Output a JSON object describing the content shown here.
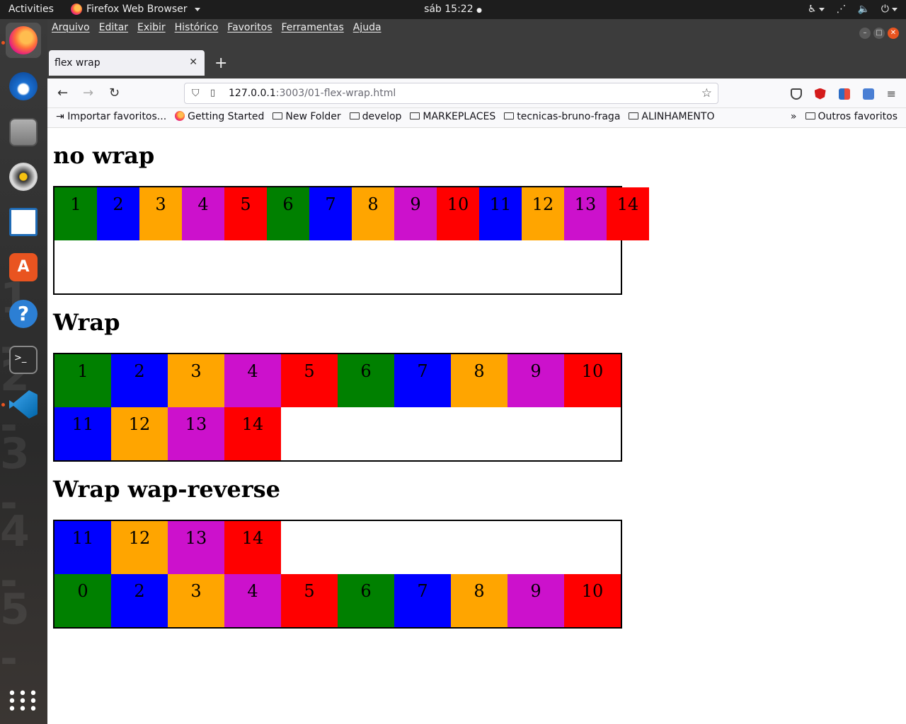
{
  "system": {
    "activities": "Activities",
    "app_name": "Firefox Web Browser",
    "clock": "sáb 15:22"
  },
  "browser": {
    "menu": [
      "Arquivo",
      "Editar",
      "Exibir",
      "Histórico",
      "Favoritos",
      "Ferramentas",
      "Ajuda"
    ],
    "tab_title": "flex wrap",
    "url_host": "127.0.0.1",
    "url_rest": ":3003/01-flex-wrap.html",
    "bookmarks": [
      "Importar favoritos...",
      "Getting Started",
      "New Folder",
      "develop",
      "MARKEPLACES",
      "tecnicas-bruno-fraga",
      "ALINHAMENTO"
    ],
    "other_bookmarks": "Outros favoritos"
  },
  "page": {
    "sections": [
      {
        "title": "no wrap",
        "items": [
          {
            "label": "1",
            "color": "green"
          },
          {
            "label": "2",
            "color": "blue"
          },
          {
            "label": "3",
            "color": "orange"
          },
          {
            "label": "4",
            "color": "purple"
          },
          {
            "label": "5",
            "color": "red"
          },
          {
            "label": "6",
            "color": "green"
          },
          {
            "label": "7",
            "color": "blue"
          },
          {
            "label": "8",
            "color": "orange"
          },
          {
            "label": "9",
            "color": "purple"
          },
          {
            "label": "10",
            "color": "red"
          },
          {
            "label": "11",
            "color": "blue"
          },
          {
            "label": "12",
            "color": "orange"
          },
          {
            "label": "13",
            "color": "purple"
          },
          {
            "label": "14",
            "color": "red"
          }
        ]
      },
      {
        "title": "Wrap",
        "items": [
          {
            "label": "1",
            "color": "green"
          },
          {
            "label": "2",
            "color": "blue"
          },
          {
            "label": "3",
            "color": "orange"
          },
          {
            "label": "4",
            "color": "purple"
          },
          {
            "label": "5",
            "color": "red"
          },
          {
            "label": "6",
            "color": "green"
          },
          {
            "label": "7",
            "color": "blue"
          },
          {
            "label": "8",
            "color": "orange"
          },
          {
            "label": "9",
            "color": "purple"
          },
          {
            "label": "10",
            "color": "red"
          },
          {
            "label": "11",
            "color": "blue"
          },
          {
            "label": "12",
            "color": "orange"
          },
          {
            "label": "13",
            "color": "purple"
          },
          {
            "label": "14",
            "color": "red"
          }
        ]
      },
      {
        "title": "Wrap wap-reverse",
        "items": [
          {
            "label": "11",
            "color": "blue"
          },
          {
            "label": "12",
            "color": "orange"
          },
          {
            "label": "13",
            "color": "purple"
          },
          {
            "label": "14",
            "color": "red"
          },
          {
            "label": "",
            "color": "none"
          },
          {
            "label": "",
            "color": "none"
          },
          {
            "label": "",
            "color": "none"
          },
          {
            "label": "",
            "color": "none"
          },
          {
            "label": "",
            "color": "none"
          },
          {
            "label": "",
            "color": "none"
          },
          {
            "label": "0",
            "color": "green"
          },
          {
            "label": "2",
            "color": "blue"
          },
          {
            "label": "3",
            "color": "orange"
          },
          {
            "label": "4",
            "color": "purple"
          },
          {
            "label": "5",
            "color": "red"
          },
          {
            "label": "6",
            "color": "green"
          },
          {
            "label": "7",
            "color": "blue"
          },
          {
            "label": "8",
            "color": "orange"
          },
          {
            "label": "9",
            "color": "purple"
          },
          {
            "label": "10",
            "color": "red"
          }
        ]
      }
    ]
  }
}
